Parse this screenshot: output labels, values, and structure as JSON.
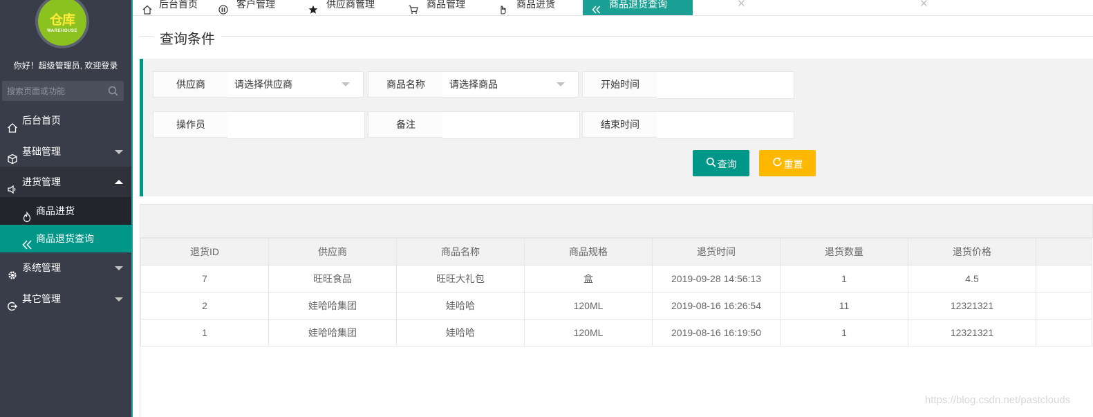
{
  "sidebar": {
    "logo_text": "仓库",
    "logo_subtext": "WAREHOUSE",
    "welcome": "你好！超级管理员, 欢迎登录",
    "search_placeholder": "搜索页面或功能",
    "items": [
      {
        "label": "后台首页",
        "icon": "home-icon"
      },
      {
        "label": "基础管理",
        "icon": "cube-icon"
      },
      {
        "label": "进货管理",
        "icon": "speaker-icon"
      },
      {
        "label": "系统管理",
        "icon": "gear-icon"
      },
      {
        "label": "其它管理",
        "icon": "exit-icon"
      }
    ],
    "subitems": [
      {
        "label": "商品进货",
        "icon": "fire-icon"
      },
      {
        "label": "商品退货查询",
        "icon": "double-chevron-left-icon"
      }
    ]
  },
  "tabs": [
    {
      "label": "后台首页",
      "icon": "home-icon",
      "closable": false
    },
    {
      "label": "客户管理",
      "icon": "pause-icon",
      "closable": true
    },
    {
      "label": "供应商管理",
      "icon": "star-icon",
      "closable": true
    },
    {
      "label": "商品管理",
      "icon": "cart-icon",
      "closable": true
    },
    {
      "label": "商品进货",
      "icon": "hand-icon",
      "closable": true
    },
    {
      "label": "商品退货查询",
      "icon": "double-chevron-left-icon",
      "closable": true,
      "active": true
    }
  ],
  "query": {
    "legend": "查询条件",
    "fields": {
      "provider": {
        "label": "供应商",
        "value": "请选择供应商"
      },
      "goods": {
        "label": "商品名称",
        "value": "请选择商品"
      },
      "start_time": {
        "label": "开始时间",
        "value": ""
      },
      "operator": {
        "label": "操作员",
        "value": ""
      },
      "remark": {
        "label": "备注",
        "value": ""
      },
      "end_time": {
        "label": "结束时间",
        "value": ""
      }
    },
    "search_label": "查询",
    "reset_label": "重置"
  },
  "table": {
    "headers": [
      "退货ID",
      "供应商",
      "商品名称",
      "商品规格",
      "退货时间",
      "退货数量",
      "退货价格"
    ],
    "rows": [
      [
        "7",
        "旺旺食品",
        "旺旺大礼包",
        "盒",
        "2019-09-28 14:56:13",
        "1",
        "4.5"
      ],
      [
        "2",
        "娃哈哈集团",
        "娃哈哈",
        "120ML",
        "2019-08-16 16:26:54",
        "11",
        "12321321"
      ],
      [
        "1",
        "娃哈哈集团",
        "娃哈哈",
        "120ML",
        "2019-08-16 16:19:50",
        "1",
        "12321321"
      ]
    ]
  },
  "watermark": "https://blog.csdn.net/pastclouds",
  "colors": {
    "sidebar_bg": "#393d49",
    "accent": "#009688",
    "tab_active": "#1aa094",
    "warn": "#ffb800",
    "logo_green": "#8cc21f"
  }
}
